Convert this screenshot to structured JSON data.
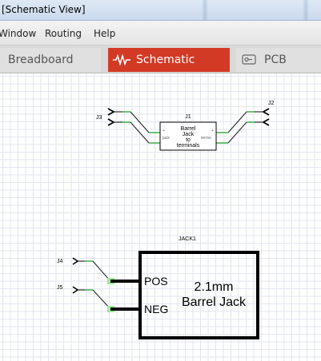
{
  "window": {
    "title": "[Schematic View]"
  },
  "menu": {
    "items": [
      "Window",
      "Routing",
      "Help"
    ]
  },
  "tabs": [
    {
      "label": "Breadboard",
      "active": false
    },
    {
      "label": "Schematic",
      "active": true,
      "icon": "resistor-icon"
    },
    {
      "label": "PCB",
      "active": false,
      "icon": "pcb-icon"
    }
  ],
  "colors": {
    "active_tab": "#d33a26",
    "wire": "#1a1a1a",
    "pin_green": "#2fa83a",
    "pin_highlight": "#9de89d"
  },
  "schematic": {
    "j1": {
      "ref": "J1",
      "body": [
        "Barrel",
        "Jack",
        "to",
        "terminals"
      ],
      "left_pin": "jack",
      "right_pin": "terms",
      "plus": "+"
    },
    "j2": {
      "ref": "J2"
    },
    "j3": {
      "ref": "J3"
    },
    "j4": {
      "ref": "J4"
    },
    "j5": {
      "ref": "J5"
    },
    "jack1": {
      "ref": "JACK1",
      "pos": "POS",
      "neg": "NEG",
      "line1": "2.1mm",
      "line2": "Barrel Jack"
    }
  }
}
